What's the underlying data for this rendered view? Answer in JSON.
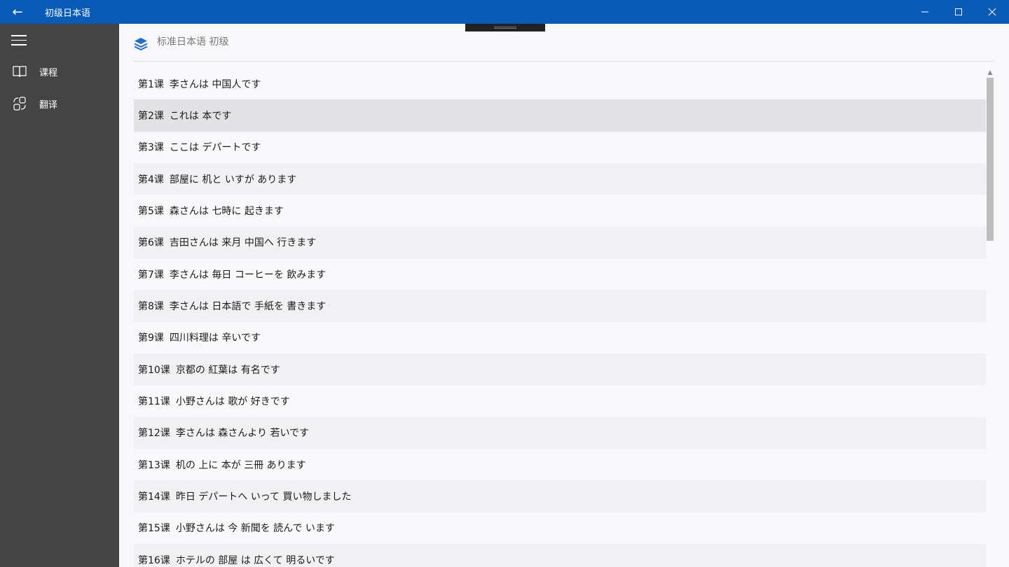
{
  "app": {
    "title": "初级日本语",
    "back_icon": "←",
    "minimize_icon": "—",
    "maximize_icon": "☐",
    "close_icon": "✕"
  },
  "sidebar": {
    "items": [
      {
        "label": "课程",
        "icon": "book-icon"
      },
      {
        "label": "翻译",
        "icon": "translate-icon"
      }
    ]
  },
  "header": {
    "title": "标准日本语 初级",
    "icon": "layers-icon"
  },
  "lessons": [
    {
      "no": "第1课",
      "title": "李さんは 中国人です"
    },
    {
      "no": "第2课",
      "title": "これは 本です"
    },
    {
      "no": "第3课",
      "title": "ここは デパートです"
    },
    {
      "no": "第4课",
      "title": "部屋に 机と いすが あります"
    },
    {
      "no": "第5课",
      "title": "森さんは 七時に 起きます"
    },
    {
      "no": "第6课",
      "title": "吉田さんは 来月 中国へ 行きます"
    },
    {
      "no": "第7课",
      "title": "李さんは 毎日 コーヒーを 飲みます"
    },
    {
      "no": "第8课",
      "title": "李さんは 日本語で 手紙を 書きます"
    },
    {
      "no": "第9课",
      "title": "四川料理は 辛いです"
    },
    {
      "no": "第10课",
      "title": "京都の 紅葉は 有名です"
    },
    {
      "no": "第11课",
      "title": "小野さんは 歌が 好きです"
    },
    {
      "no": "第12课",
      "title": "李さんは 森さんより 若いです"
    },
    {
      "no": "第13课",
      "title": "机の 上に 本が 三冊 あります"
    },
    {
      "no": "第14课",
      "title": "昨日 デパートへ いって 買い物しました"
    },
    {
      "no": "第15课",
      "title": "小野さんは 今 新聞を 読んで います"
    },
    {
      "no": "第16课",
      "title": "ホテルの 部屋 は 広くて 明るいです"
    }
  ],
  "selected_lesson_index": 1,
  "scroll": {
    "up_arrow": "▲"
  },
  "colors": {
    "titlebar": "#0a5bb8",
    "sidebar": "#444444",
    "accent": "#1e6fd0"
  }
}
